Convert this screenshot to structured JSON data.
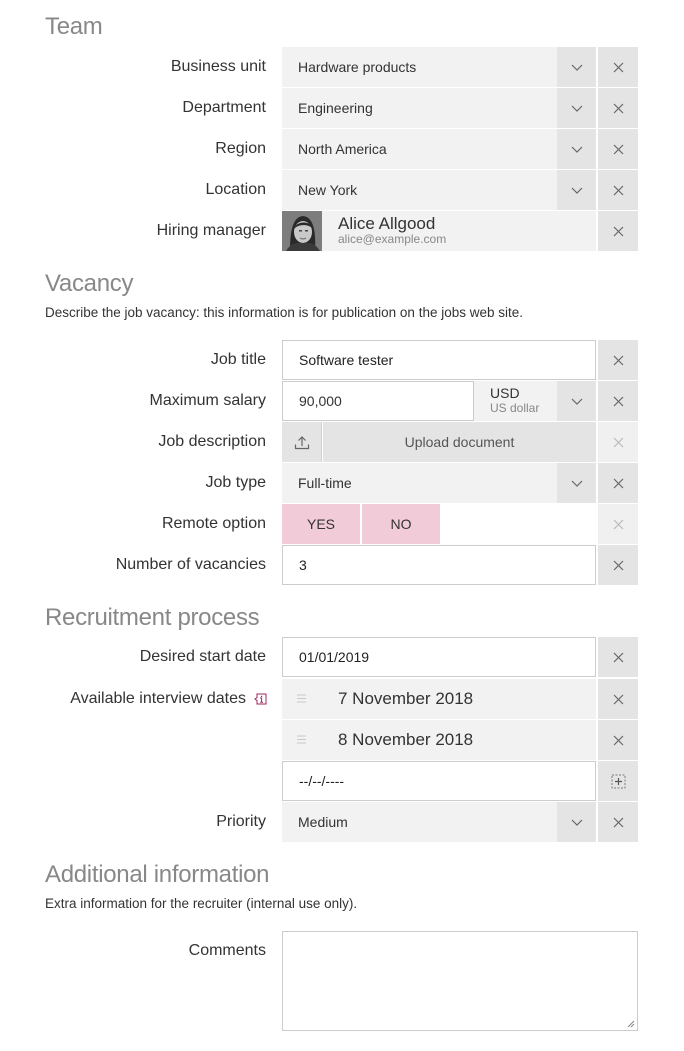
{
  "sections": {
    "team": {
      "title": "Team"
    },
    "vacancy": {
      "title": "Vacancy",
      "description": "Describe the job vacancy: this information is for publication on the jobs web site."
    },
    "recruitment": {
      "title": "Recruitment process"
    },
    "additional": {
      "title": "Additional information",
      "description": "Extra information for the recruiter (internal use only)."
    }
  },
  "team": {
    "business_unit": {
      "label": "Business unit",
      "value": "Hardware products"
    },
    "department": {
      "label": "Department",
      "value": "Engineering"
    },
    "region": {
      "label": "Region",
      "value": "North America"
    },
    "location": {
      "label": "Location",
      "value": "New York"
    },
    "hiring_manager": {
      "label": "Hiring manager",
      "name": "Alice Allgood",
      "email": "alice@example.com"
    }
  },
  "vacancy": {
    "job_title": {
      "label": "Job title",
      "value": "Software tester"
    },
    "max_salary": {
      "label": "Maximum salary",
      "value": "90,000",
      "currency_code": "USD",
      "currency_name": "US dollar"
    },
    "job_description": {
      "label": "Job description",
      "button": "Upload document"
    },
    "job_type": {
      "label": "Job type",
      "value": "Full-time"
    },
    "remote_option": {
      "label": "Remote option",
      "options": [
        "YES",
        "NO"
      ]
    },
    "vacancies": {
      "label": "Number of vacancies",
      "value": "3"
    }
  },
  "recruitment": {
    "start_date": {
      "label": "Desired start date",
      "value": "01/01/2019"
    },
    "interview_dates": {
      "label": "Available interview dates",
      "items": [
        "7 November 2018",
        "8 November 2018"
      ],
      "new_placeholder": "--/--/----"
    },
    "priority": {
      "label": "Priority",
      "value": "Medium"
    }
  },
  "additional": {
    "comments": {
      "label": "Comments",
      "value": ""
    }
  },
  "colors": {
    "toggle_bg": "#f1cbd8",
    "info_icon": "#a0265c",
    "field_bg": "#f2f2f2",
    "button_bg": "#e4e4e4"
  }
}
